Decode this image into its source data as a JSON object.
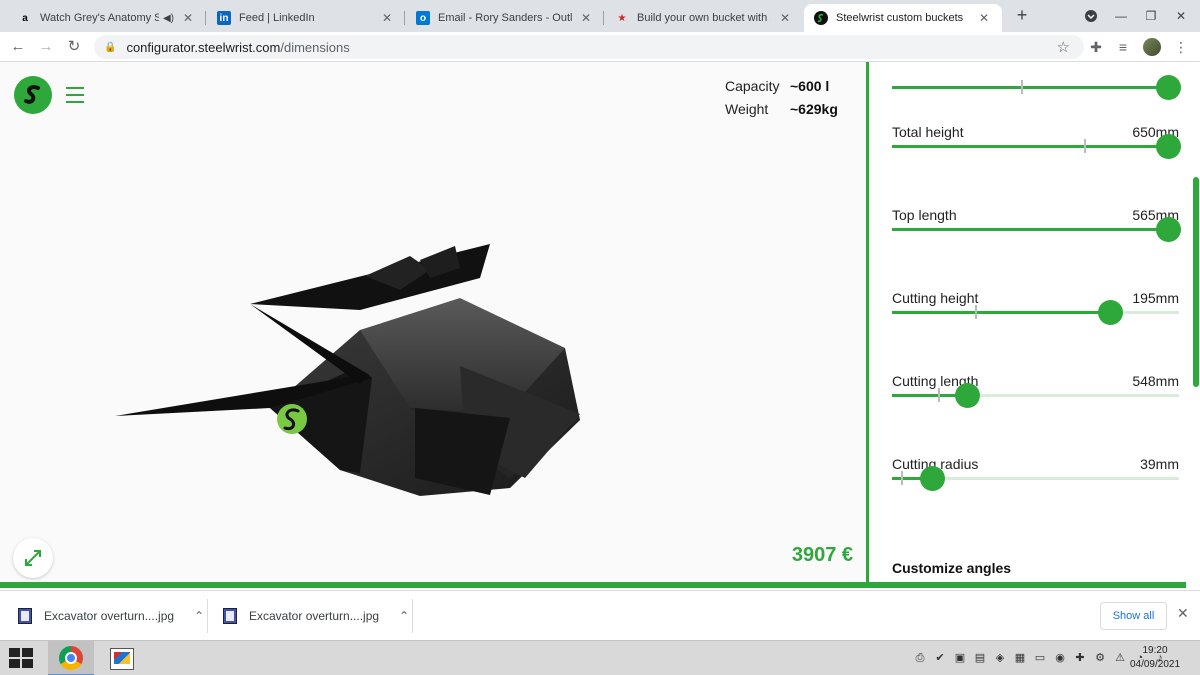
{
  "browser": {
    "tabs": [
      {
        "title": "Watch Grey's Anatomy Season",
        "favicon": "amazon-icon",
        "audio": true,
        "active": false
      },
      {
        "title": "Feed | LinkedIn",
        "favicon": "linkedin-icon",
        "audio": false,
        "active": false
      },
      {
        "title": "Email - Rory Sanders - Outlook",
        "favicon": "outlook-icon",
        "audio": false,
        "active": false
      },
      {
        "title": "Build your own bucket with Steelwrist",
        "favicon": "steelwrist-red-icon",
        "audio": false,
        "active": false
      },
      {
        "title": "Steelwrist custom buckets",
        "favicon": "steelwrist-icon",
        "audio": false,
        "active": true
      }
    ],
    "url_host": "configurator.steelwrist.com",
    "url_path": "/dimensions"
  },
  "page": {
    "stats": [
      {
        "label": "Capacity",
        "value": "~600 l"
      },
      {
        "label": "Weight",
        "value": "~629kg"
      }
    ],
    "price": "3907 €",
    "sliders": [
      {
        "label": "",
        "value_text": "",
        "fraction": 0.96,
        "tick": 0.45
      },
      {
        "label": "Total height",
        "value_text": "650mm",
        "fraction": 0.96,
        "tick": 0.67
      },
      {
        "label": "Top length",
        "value_text": "565mm",
        "fraction": 0.96,
        "tick": 0.95
      },
      {
        "label": "Cutting height",
        "value_text": "195mm",
        "fraction": 0.76,
        "tick": 0.29
      },
      {
        "label": "Cutting length",
        "value_text": "548mm",
        "fraction": 0.26,
        "tick": 0.16
      },
      {
        "label": "Cutting radius",
        "value_text": "39mm",
        "fraction": 0.14,
        "tick": 0.03
      }
    ],
    "section_title": "Customize angles"
  },
  "downloads": {
    "items": [
      {
        "name": "Excavator overturn....jpg"
      },
      {
        "name": "Excavator overturn....jpg"
      }
    ],
    "show_all": "Show all"
  },
  "taskbar": {
    "time": "19:20",
    "date": "04/09/2021"
  },
  "colors": {
    "brand_green": "#2ea83a",
    "track_light": "#d7ecd9"
  }
}
